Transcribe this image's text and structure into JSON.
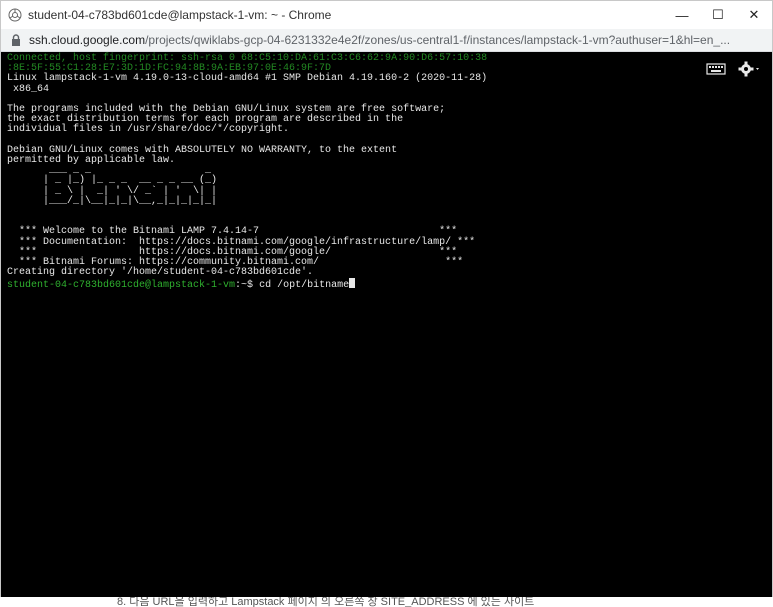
{
  "window": {
    "title": "student-04-c783bd601cde@lampstack-1-vm: ~ - Chrome",
    "controls": {
      "minimize": "—",
      "maximize": "☐",
      "close": "✕"
    }
  },
  "urlbar": {
    "host": "ssh.cloud.google.com",
    "path": "/projects/qwiklabs-gcp-04-6231332e4e2f/zones/us-central1-f/instances/lampstack-1-vm?authuser=1&hl=en_..."
  },
  "terminal": {
    "line_connected_1": "Connected, host fingerprint: ssh-rsa 0 68:C5:10:DA:61:C3:C6:62:9A:90:D6:57:10:38",
    "line_connected_2": ":8E:5F:55:C1:28:E7:3D:1D:FC:94:8B:9A:EB:97:0E:46:9F:7D",
    "line_uname_1": "Linux lampstack-1-vm 4.19.0-13-cloud-amd64 #1 SMP Debian 4.19.160-2 (2020-11-28)",
    "line_uname_2": " x86_64",
    "motd_1": "The programs included with the Debian GNU/Linux system are free software;",
    "motd_2": "the exact distribution terms for each program are described in the",
    "motd_3": "individual files in /usr/share/doc/*/copyright.",
    "motd_4": "Debian GNU/Linux comes with ABSOLUTELY NO WARRANTY, to the extent",
    "motd_5": "permitted by applicable law.",
    "banner_1": "       ___ _ _                   _",
    "banner_2": "      | _ |_) |_ _ _  __ _ _ __ (_)",
    "banner_3": "      | _ \\ |  _| ' \\/ _` | '  \\| |",
    "banner_4": "      |___/_|\\__|_|_|\\__,_|_|_|_|_|",
    "welcome_1": "  *** Welcome to the Bitnami LAMP 7.4.14-7                              ***",
    "welcome_2": "  *** Documentation:  https://docs.bitnami.com/google/infrastructure/lamp/ ***",
    "welcome_3": "  ***                 https://docs.bitnami.com/google/                  ***",
    "welcome_4": "  *** Bitnami Forums: https://community.bitnami.com/                     ***",
    "creating_dir": "Creating directory '/home/student-04-c783bd601cde'.",
    "prompt": "student-04-c783bd601cde@lampstack-1-vm",
    "prompt_suffix": ":~$ ",
    "command": "cd /opt/bitname"
  },
  "icons": {
    "app": "chrome-icon",
    "lock": "lock-icon",
    "keyboard": "keyboard-icon",
    "settings": "gear-icon"
  },
  "caption": "8. 다음 URL을 입력하고 Lampstack 페이지 의 오른쪽 창 SITE_ADDRESS 에 있는 사이트"
}
